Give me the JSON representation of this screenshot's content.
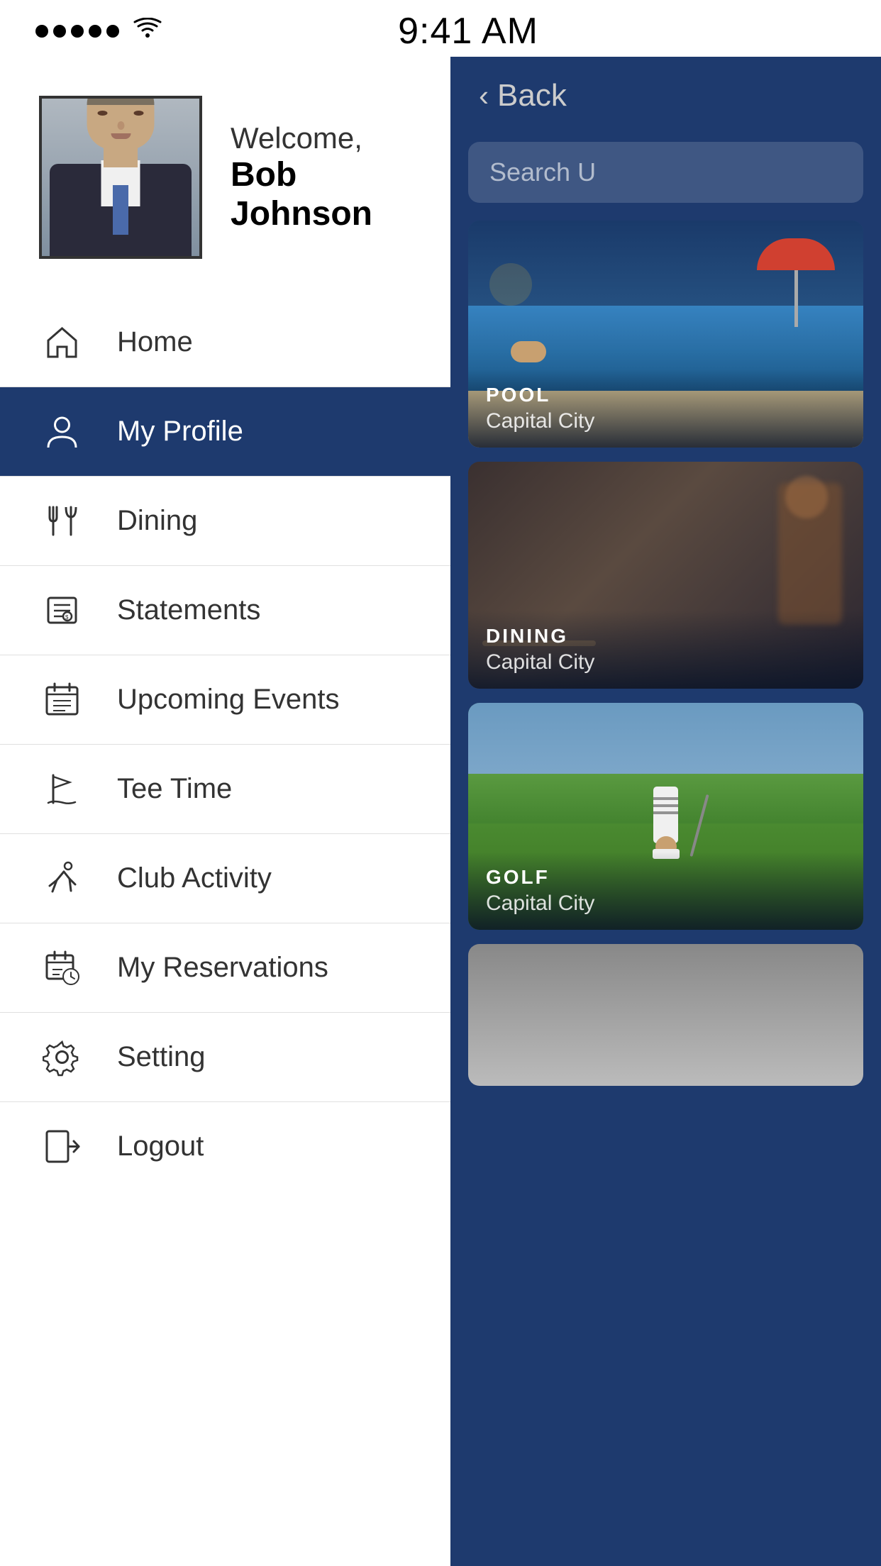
{
  "statusBar": {
    "time": "9:41 AM",
    "signalDots": 5,
    "wifiIcon": "wifi"
  },
  "user": {
    "greeting": "Welcome,",
    "name": "Bob Johnson"
  },
  "nav": {
    "items": [
      {
        "id": "home",
        "label": "Home",
        "icon": "home",
        "active": false
      },
      {
        "id": "my-profile",
        "label": "My Profile",
        "icon": "person",
        "active": true
      },
      {
        "id": "dining",
        "label": "Dining",
        "icon": "dining",
        "active": false
      },
      {
        "id": "statements",
        "label": "Statements",
        "icon": "statements",
        "active": false
      },
      {
        "id": "upcoming-events",
        "label": "Upcoming Events",
        "icon": "calendar",
        "active": false
      },
      {
        "id": "tee-time",
        "label": "Tee Time",
        "icon": "flag",
        "active": false
      },
      {
        "id": "club-activity",
        "label": "Club Activity",
        "icon": "running",
        "active": false
      },
      {
        "id": "my-reservations",
        "label": "My Reservations",
        "icon": "reservations",
        "active": false
      },
      {
        "id": "setting",
        "label": "Setting",
        "icon": "gear",
        "active": false
      },
      {
        "id": "logout",
        "label": "Logout",
        "icon": "logout",
        "active": false
      }
    ]
  },
  "rightPanel": {
    "backLabel": "Back",
    "searchPlaceholder": "Search U",
    "cards": [
      {
        "id": "pool",
        "category": "POOL",
        "name": "Capital City"
      },
      {
        "id": "dining",
        "category": "DINING",
        "name": "Capital City"
      },
      {
        "id": "golf",
        "category": "GOLF",
        "name": "Capital City"
      },
      {
        "id": "extra",
        "category": "",
        "name": ""
      }
    ]
  }
}
